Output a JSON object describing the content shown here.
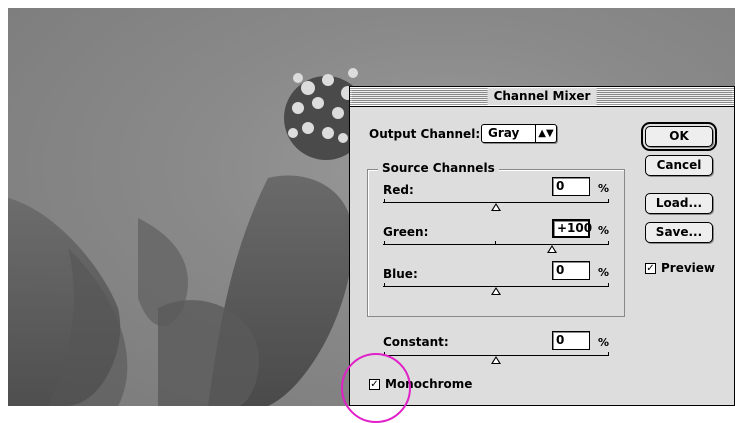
{
  "dialog": {
    "title": "Channel Mixer",
    "output_channel_label": "Output Channel:",
    "output_channel_value": "Gray",
    "source_group_title": "Source Channels",
    "channels": [
      {
        "label": "Red:",
        "value": "0",
        "unit": "%",
        "level": 0
      },
      {
        "label": "Green:",
        "value": "+100",
        "unit": "%",
        "level": 100
      },
      {
        "label": "Blue:",
        "value": "0",
        "unit": "%",
        "level": 0
      }
    ],
    "constant": {
      "label": "Constant:",
      "value": "0",
      "unit": "%",
      "level": 0
    },
    "monochrome_label": "Monochrome",
    "monochrome_checked": true,
    "buttons": {
      "ok": "OK",
      "cancel": "Cancel",
      "load": "Load...",
      "save": "Save..."
    },
    "preview_label": "Preview",
    "preview_checked": true
  },
  "colors": {
    "highlight_circle": "#e020c8"
  }
}
